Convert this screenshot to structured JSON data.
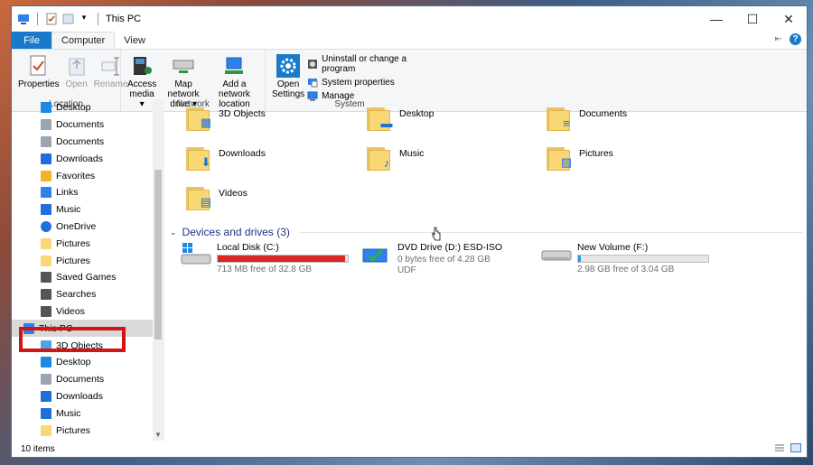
{
  "window": {
    "title": "This PC"
  },
  "tabs": [
    "File",
    "Computer",
    "View"
  ],
  "ribbon": {
    "location": {
      "label": "Location",
      "buttons": [
        "Properties",
        "Open",
        "Rename"
      ]
    },
    "network": {
      "label": "Network",
      "buttons": [
        {
          "l1": "Access",
          "l2": "media ▾"
        },
        {
          "l1": "Map network",
          "l2": "drive ▾"
        },
        {
          "l1": "Add a network",
          "l2": "location"
        }
      ]
    },
    "system": {
      "label": "System",
      "open_settings": {
        "l1": "Open",
        "l2": "Settings"
      },
      "items": [
        "Uninstall or change a program",
        "System properties",
        "Manage"
      ]
    }
  },
  "nav": {
    "items": [
      {
        "label": "Desktop",
        "icon": "desktop-icon",
        "color": "#1e88e5"
      },
      {
        "label": "Documents",
        "icon": "documents-icon",
        "color": "#9aa5b1"
      },
      {
        "label": "Documents",
        "icon": "documents-icon",
        "color": "#9aa5b1"
      },
      {
        "label": "Downloads",
        "icon": "download-icon",
        "color": "#1e6fd9"
      },
      {
        "label": "Favorites",
        "icon": "star-icon",
        "color": "#f0b429"
      },
      {
        "label": "Links",
        "icon": "link-icon",
        "color": "#2f80ed"
      },
      {
        "label": "Music",
        "icon": "music-icon",
        "color": "#1e6fd9"
      },
      {
        "label": "OneDrive",
        "icon": "cloud-icon",
        "color": "#1e6fd9"
      },
      {
        "label": "Pictures",
        "icon": "pictures-icon",
        "color": "#f8d775"
      },
      {
        "label": "Pictures",
        "icon": "folder-icon",
        "color": "#f8d775"
      },
      {
        "label": "Saved Games",
        "icon": "games-icon",
        "color": "#555555"
      },
      {
        "label": "Searches",
        "icon": "search-icon",
        "color": "#555555"
      },
      {
        "label": "Videos",
        "icon": "video-icon",
        "color": "#555555"
      },
      {
        "label": "This PC",
        "icon": "computer-icon",
        "color": "#2f80ed"
      },
      {
        "label": "3D Objects",
        "icon": "cube-icon",
        "color": "#4fa3e0"
      },
      {
        "label": "Desktop",
        "icon": "desktop-icon",
        "color": "#1e88e5"
      },
      {
        "label": "Documents",
        "icon": "documents-icon",
        "color": "#9aa5b1"
      },
      {
        "label": "Downloads",
        "icon": "download-icon",
        "color": "#1e6fd9"
      },
      {
        "label": "Music",
        "icon": "music-icon",
        "color": "#1e6fd9"
      },
      {
        "label": "Pictures",
        "icon": "pictures-icon",
        "color": "#f8d775"
      }
    ],
    "selected_index": 13
  },
  "folders": [
    {
      "label": "3D Objects",
      "overlay": "▦"
    },
    {
      "label": "Desktop",
      "overlay": "▬"
    },
    {
      "label": "Documents",
      "overlay": "≡"
    },
    {
      "label": "Downloads",
      "overlay": "⬇"
    },
    {
      "label": "Music",
      "overlay": "♪"
    },
    {
      "label": "Pictures",
      "overlay": "▨"
    },
    {
      "label": "Videos",
      "overlay": "▤"
    }
  ],
  "devices": {
    "heading": "Devices and drives (3)",
    "drives": [
      {
        "name": "Local Disk (C:)",
        "free": "713 MB free of 32.8 GB",
        "used_fraction": 0.98,
        "bar_color": "#da2626",
        "fs": ""
      },
      {
        "name": "DVD Drive (D:) ESD-ISO",
        "free": "0 bytes free of 4.28 GB",
        "used_fraction": null,
        "bar_color": "",
        "fs": "UDF"
      },
      {
        "name": "New Volume (F:)",
        "free": "2.98 GB free of 3.04 GB",
        "used_fraction": 0.02,
        "bar_color": "#26a0da",
        "fs": ""
      }
    ]
  },
  "status": {
    "count": "10 items"
  }
}
